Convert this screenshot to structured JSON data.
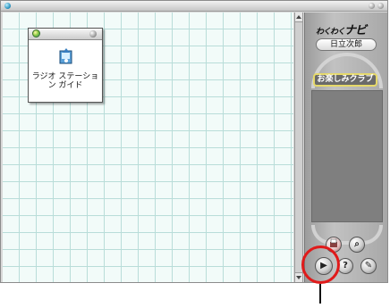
{
  "window": {
    "controls": [
      "minimize-icon",
      "close-icon"
    ]
  },
  "tile": {
    "label": "ラジオ ステーション ガイド",
    "icons": [
      "globe-icon",
      "close-icon",
      "app-icon"
    ]
  },
  "panel": {
    "logo": "わくわくナビ",
    "logo_small": "わくわく",
    "logo_big": "ナビ",
    "user_name": "日立次郎",
    "club_button": "お楽しみクラブ",
    "buttons": [
      "printer-icon",
      "search-icon",
      "play-icon",
      "help-icon",
      "bulb-icon"
    ],
    "play_glyph": "▶",
    "help_glyph": "?",
    "search_glyph": "⌕",
    "bulb_glyph": "✎"
  },
  "colors": {
    "grid_bg": "#f2fbf9",
    "grid_line": "#b9ddd9",
    "callout": "#e01a1a",
    "club_border": "#e6d96a"
  }
}
